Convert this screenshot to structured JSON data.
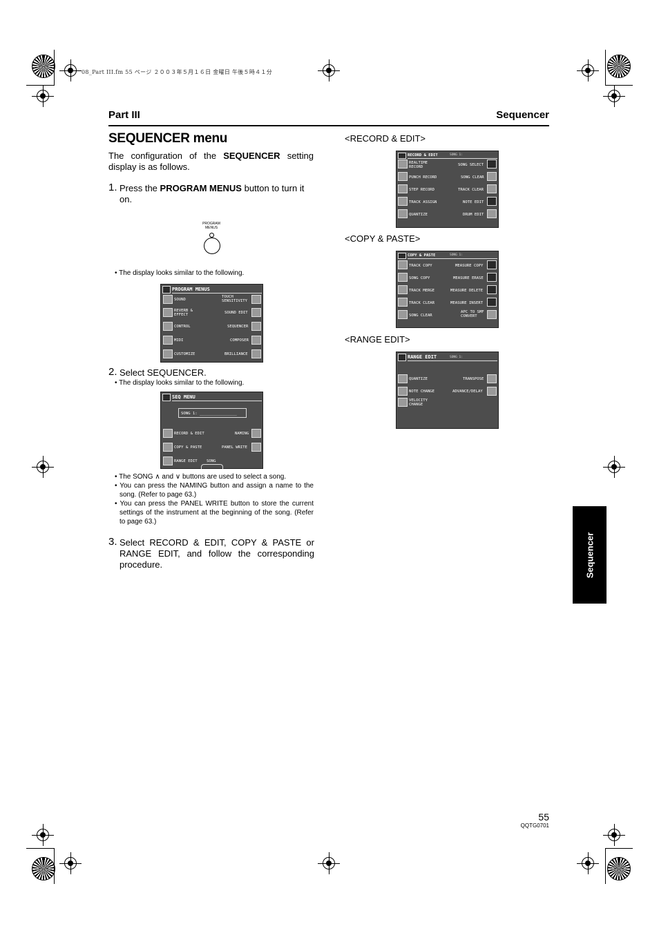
{
  "print_header": "08_Part III.fm  55 ページ  ２００３年５月１６日  金曜日  午後５時４１分",
  "header": {
    "part": "Part III",
    "section": "Sequencer"
  },
  "title": "SEQUENCER menu",
  "intro": {
    "pre": "The configuration of the ",
    "bold": "SEQUENCER",
    "post": " setting display is as follows."
  },
  "step1": {
    "num": "1.",
    "pre": "Press the ",
    "bold": "PROGRAM MENUS",
    "post": " button to turn it on."
  },
  "program_menus_button": {
    "label_line1": "PROGRAM",
    "label_line2": "MENUS"
  },
  "note_display1": "• The display looks similar to the following.",
  "program_menus_screen": {
    "title": "PROGRAM MENUS",
    "left": [
      "SOUND",
      "REVERB &\nEFFECT",
      "CONTROL",
      "MIDI",
      "CUSTOMIZE"
    ],
    "right": [
      "TOUCH\nSENSITIVITY",
      "SOUND EDIT",
      "SEQUENCER",
      "COMPOSER",
      "BRILLIANCE"
    ]
  },
  "step2": {
    "num": "2.",
    "text": "Select SEQUENCER."
  },
  "note_display2": "• The display looks similar to the following.",
  "seq_menu_screen": {
    "title": "SEQ MENU",
    "song_field": "SONG 1: ________________",
    "left": [
      "RECORD & EDIT",
      "COPY & PASTE",
      "RANGE EDIT"
    ],
    "right": [
      "NAMING",
      "PANEL WRITE"
    ],
    "song_label": "SONG"
  },
  "notes2": [
    "• The SONG ∧ and ∨ buttons are used to select a song.",
    "• You can press the NAMING button and assign a name to the song. (Refer to page 63.)",
    "• You can press the PANEL WRITE button to store the current settings of the instrument at the beginning of the song. (Refer to page 63.)"
  ],
  "step3": {
    "num": "3.",
    "text": "Select RECORD & EDIT, COPY & PASTE or RANGE EDIT, and follow the corresponding procedure."
  },
  "record_edit": {
    "heading": "<RECORD & EDIT>",
    "title": "RECORD & EDIT",
    "song": "SONG 1:",
    "left": [
      "REALTIME\nRECORD",
      "PUNCH RECORD",
      "STEP RECORD",
      "TRACK ASSIGN",
      "QUANTIZE"
    ],
    "right": [
      "SONG SELECT",
      "SONG CLEAR",
      "TRACK CLEAR",
      "NOTE EDIT",
      "DRUM EDIT"
    ]
  },
  "copy_paste": {
    "heading": "<COPY & PASTE>",
    "title": "COPY & PASTE",
    "song": "SONG 1:",
    "left": [
      "TRACK COPY",
      "SONG COPY",
      "TRACK MERGE",
      "TRACK CLEAR",
      "SONG CLEAR"
    ],
    "right": [
      "MEASURE COPY",
      "MEASURE ERASE",
      "MEASURE DELETE",
      "MEASURE INSERT",
      "APC TO SMF\nCONVERT"
    ]
  },
  "range_edit": {
    "heading": "<RANGE EDIT>",
    "title": "RANGE EDIT",
    "song": "SONG 1:",
    "left": [
      "QUANTIZE",
      "NOTE CHANGE",
      "VELOCITY\nCHANGE"
    ],
    "right": [
      "TRANSPOSE",
      "ADVANCE/DELAY"
    ]
  },
  "side_tab": "Sequencer",
  "page_number": "55",
  "doc_code": "QQTG0701"
}
